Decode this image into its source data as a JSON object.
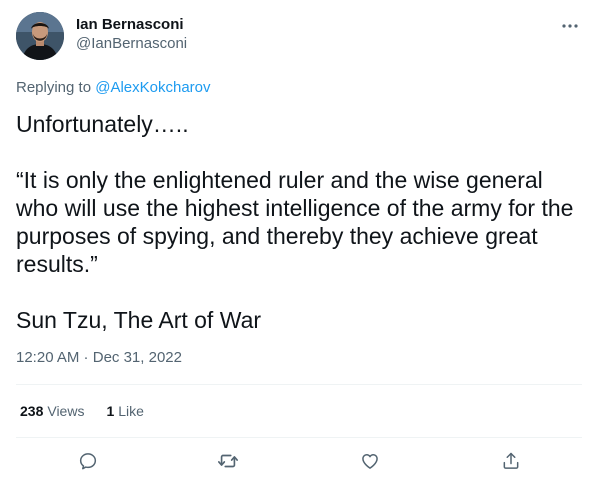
{
  "author": {
    "display_name": "Ian Bernasconi",
    "handle": "@IanBernasconi"
  },
  "more_icon": "more-horizontal-icon",
  "reply": {
    "prefix": "Replying to",
    "target": "@AlexKokcharov"
  },
  "body": {
    "line1": "Unfortunately…..",
    "quote": "“It is only the enlightened ruler and the wise general who will use the highest intelligence of the army for the purposes of spying, and thereby they achieve great results.”",
    "attribution": "Sun Tzu, The Art of War"
  },
  "timestamp": {
    "time": "12:20 AM",
    "separator": " · ",
    "date": "Dec 31, 2022"
  },
  "stats": {
    "views_count": "238",
    "views_label": "Views",
    "likes_count": "1",
    "likes_label": "Like"
  },
  "actions": [
    "reply-icon",
    "retweet-icon",
    "like-icon",
    "share-icon"
  ],
  "colors": {
    "accent": "#1d9bf0",
    "text_primary": "#0f1419",
    "text_secondary": "#536471",
    "divider": "#eff3f4"
  }
}
